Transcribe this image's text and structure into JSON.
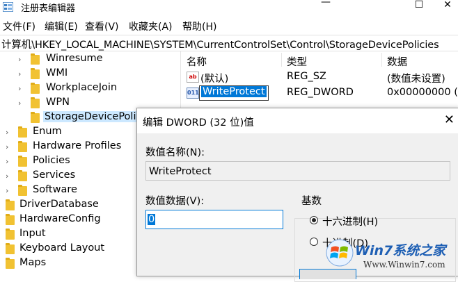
{
  "window": {
    "title": "注册表编辑器",
    "minimize": "—",
    "maximize": "☐",
    "close": "✕"
  },
  "menu": [
    "文件(F)",
    "编辑(E)",
    "查看(V)",
    "收藏夹(A)",
    "帮助(H)"
  ],
  "address": "计算机\\HKEY_LOCAL_MACHINE\\SYSTEM\\CurrentControlSet\\Control\\StorageDevicePolicies",
  "tree": [
    {
      "label": "Winresume",
      "chevron": "›"
    },
    {
      "label": "WMI",
      "chevron": "›"
    },
    {
      "label": "WorkplaceJoin",
      "chevron": "›"
    },
    {
      "label": "WPN",
      "chevron": "›"
    },
    {
      "label": "StorageDevicePoli",
      "chevron": ""
    },
    {
      "label": "Enum",
      "chevron": "›"
    },
    {
      "label": "Hardware Profiles",
      "chevron": "›"
    },
    {
      "label": "Policies",
      "chevron": "›"
    },
    {
      "label": "Services",
      "chevron": "›"
    },
    {
      "label": "Software",
      "chevron": "›"
    },
    {
      "label": "DriverDatabase",
      "chevron": ""
    },
    {
      "label": "HardwareConfig",
      "chevron": ""
    },
    {
      "label": "Input",
      "chevron": ""
    },
    {
      "label": "Keyboard Layout",
      "chevron": ""
    },
    {
      "label": "Maps",
      "chevron": ""
    }
  ],
  "values": {
    "headers": {
      "name": "名称",
      "type": "类型",
      "data": "数据"
    },
    "rows": [
      {
        "icon": "ab",
        "name": "(默认)",
        "type": "REG_SZ",
        "data": "(数值未设置)"
      },
      {
        "icon": "011",
        "name": "WriteProtect",
        "type": "REG_DWORD",
        "data": "0x00000000 (0"
      }
    ]
  },
  "dialog": {
    "title": "编辑 DWORD (32 位)值",
    "close": "✕",
    "name_label": "数值名称(N):",
    "name_value": "WriteProtect",
    "data_label": "数值数据(V):",
    "data_value": "0",
    "base_label": "基数",
    "radio_hex": "十六进制(H)",
    "radio_dec": "十进制(D)",
    "selected_base": "hex"
  },
  "watermark": {
    "brand": "Win7系统之家",
    "url": "Www.Winwin7.com"
  }
}
